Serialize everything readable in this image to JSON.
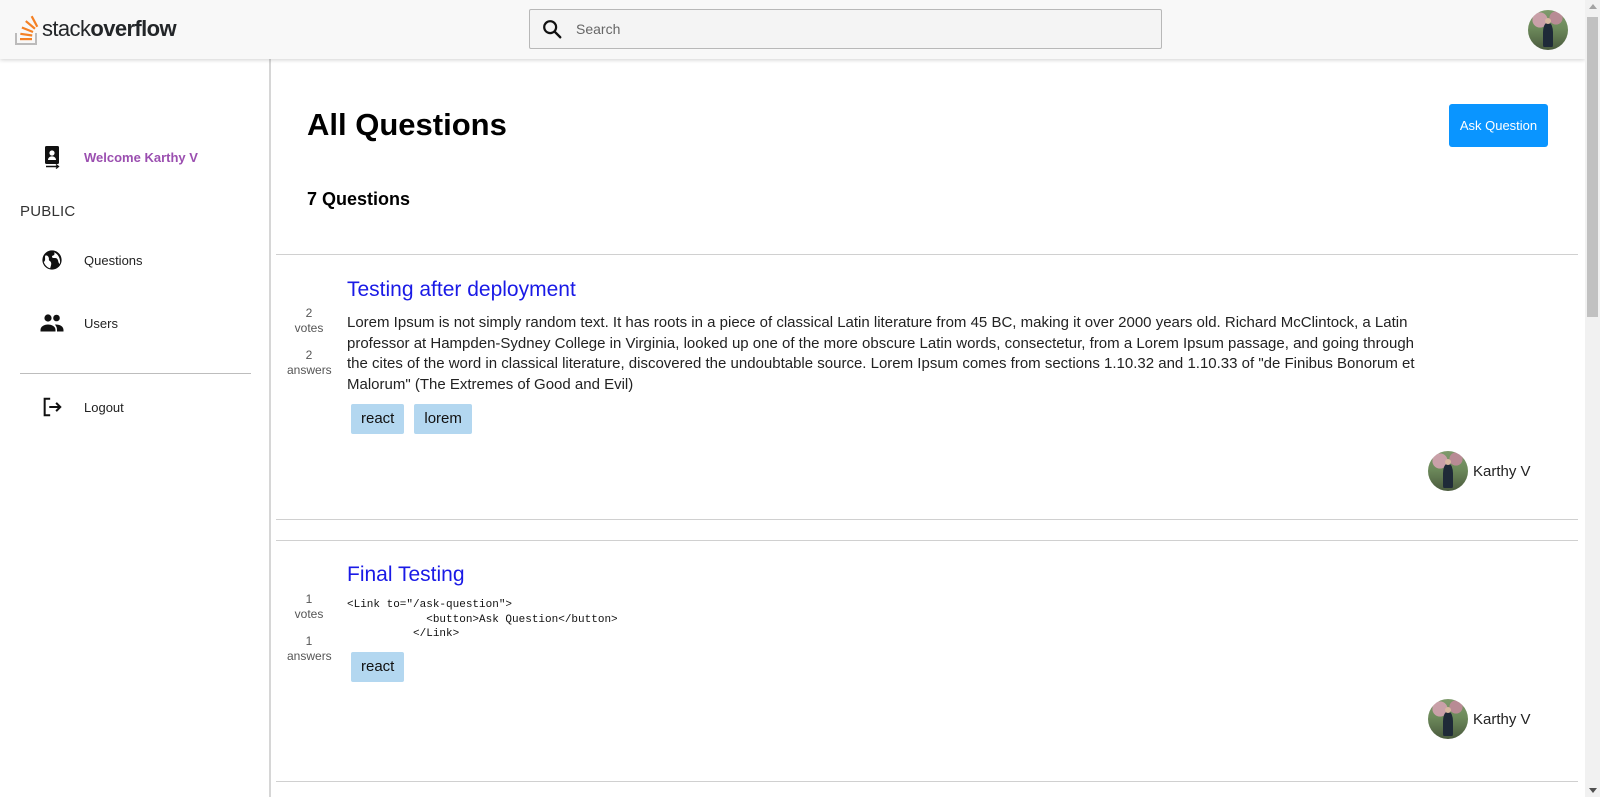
{
  "header": {
    "logo_light": "stack",
    "logo_bold": "overflow",
    "search_placeholder": "Search",
    "icons": {
      "search": "search-icon",
      "avatar": "user-avatar"
    }
  },
  "sidebar": {
    "welcome": "Welcome Karthy V",
    "section_public": "PUBLIC",
    "items": [
      {
        "label": "Questions",
        "icon": "globe-icon"
      },
      {
        "label": "Users",
        "icon": "people-icon"
      }
    ],
    "logout": "Logout"
  },
  "main": {
    "title": "All Questions",
    "ask_button": "Ask Question",
    "count_label": "7 Questions",
    "questions": [
      {
        "votes": "2",
        "votes_label": "votes",
        "answers": "2",
        "answers_label": "answers",
        "title": "Testing after deployment",
        "body": "Lorem Ipsum is not simply random text. It has roots in a piece of classical Latin literature from 45 BC, making it over 2000 years old. Richard McClintock, a Latin professor at Hampden-Sydney College in Virginia, looked up one of the more obscure Latin words, consectetur, from a Lorem Ipsum passage, and going through the cites of the word in classical literature, discovered the undoubtable source. Lorem Ipsum comes from sections 1.10.32 and 1.10.33 of \"de Finibus Bonorum et Malorum\" (The Extremes of Good and Evil)",
        "tags": [
          "react",
          "lorem"
        ],
        "author": "Karthy V"
      },
      {
        "votes": "1",
        "votes_label": "votes",
        "answers": "1",
        "answers_label": "answers",
        "title": "Final Testing",
        "code": "<Link to=\"/ask-question\">\n            <button>Ask Question</button>\n          </Link>",
        "tags": [
          "react"
        ],
        "author": "Karthy V"
      }
    ]
  },
  "colors": {
    "accent": "#0a95ff",
    "link": "#1a1ae6",
    "tag_bg": "#b3d7f0",
    "welcome": "#9b4fb0",
    "logo_orange": "#f48024"
  }
}
